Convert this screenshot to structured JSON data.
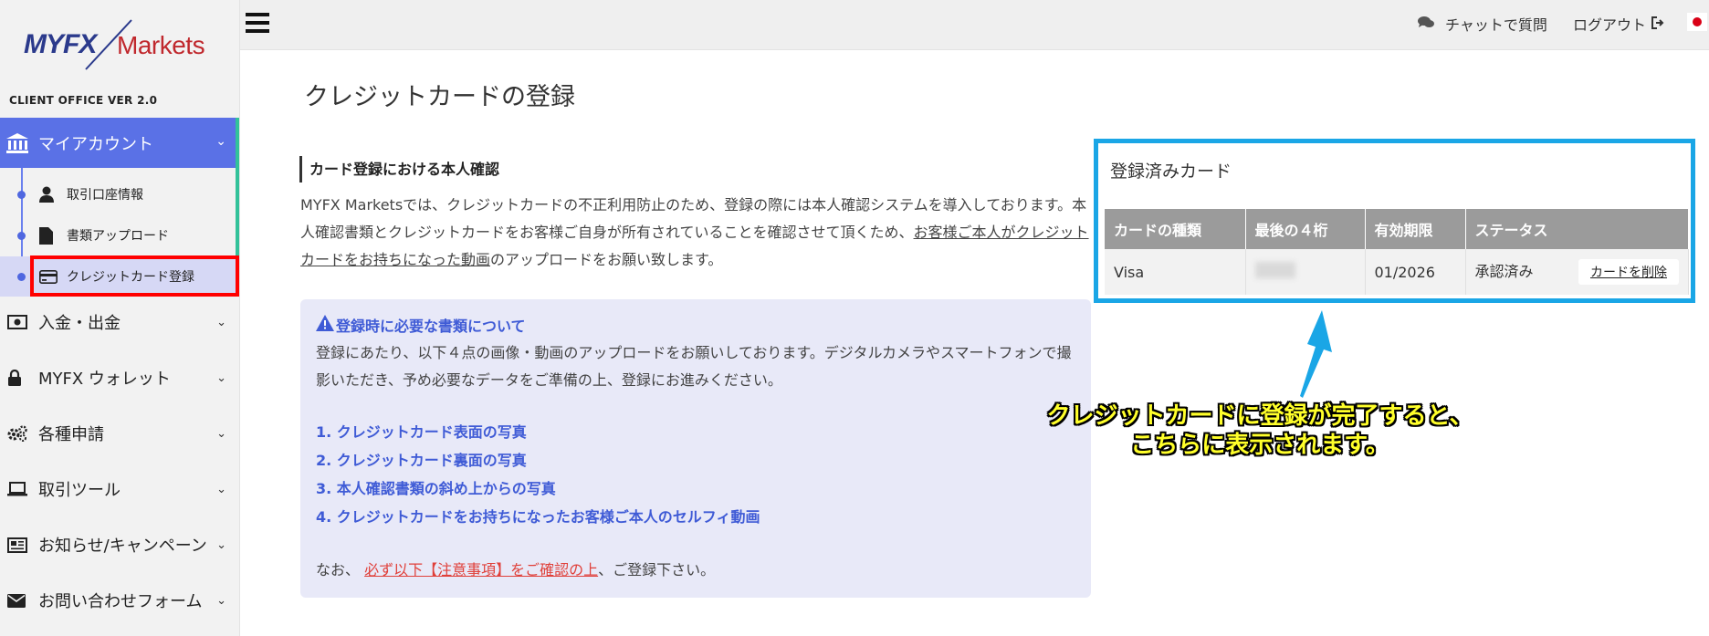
{
  "brand": {
    "logo_main": "MYFX",
    "logo_sub": "Markets",
    "client_office": "CLIENT OFFICE VER 2.0"
  },
  "sidebar": {
    "account_header": "マイアカウント",
    "sub_items": [
      {
        "label": "取引口座情報",
        "icon": "user-icon"
      },
      {
        "label": "書類アップロード",
        "icon": "file-icon"
      },
      {
        "label": "クレジットカード登録",
        "icon": "credit-card-icon",
        "active": true
      }
    ],
    "items": [
      {
        "label": "入金・出金",
        "icon": "money-icon"
      },
      {
        "label": "MYFX ウォレット",
        "icon": "lock-icon"
      },
      {
        "label": "各種申請",
        "icon": "gears-icon"
      },
      {
        "label": "取引ツール",
        "icon": "laptop-icon"
      },
      {
        "label": "お知らせ/キャンペーン",
        "icon": "newspaper-icon"
      },
      {
        "label": "お問い合わせフォーム",
        "icon": "envelope-icon"
      }
    ]
  },
  "header": {
    "chat_label": "チャットで質問",
    "logout_label": "ログアウト"
  },
  "main": {
    "page_title": "クレジットカードの登録",
    "section_title": "カード登録における本人確認",
    "intro_part1": "MYFX Marketsでは、クレジットカードの不正利用防止のため、登録の際には本人確認システムを導入しております。本人確認書類とクレジットカードをお客様ご自身が所有されていることを確認させて頂くため、",
    "intro_link": "お客様ご本人がクレジットカードをお持ちになった動画",
    "intro_part2": "のアップロードをお願い致します。",
    "notice": {
      "title": "登録時に必要な書類について",
      "body": "登録にあたり、以下４点の画像・動画のアップロードをお願いしております。デジタルカメラやスマートフォンで撮影いただき、予め必要なデータをご準備の上、登録にお進みください。",
      "steps": [
        "1. クレジットカード表面の写真",
        "2. クレジットカード裏面の写真",
        "3. 本人確認書類の斜め上からの写真",
        "4. クレジットカードをお持ちになったお客様ご本人のセルフィ動画"
      ],
      "footer_prefix": "なお、",
      "footer_link": "必ず以下【注意事項】をご確認の上",
      "footer_suffix": "、ご登録下さい。"
    }
  },
  "registered_cards": {
    "title": "登録済みカード",
    "columns": [
      "カードの種類",
      "最後の４桁",
      "有効期限",
      "ステータス"
    ],
    "rows": [
      {
        "type": "Visa",
        "last4": "",
        "expiry": "01/2026",
        "status": "承認済み",
        "action": "カードを削除"
      }
    ]
  },
  "annotation": {
    "line1": "クレジットカードに登録が完了すると、",
    "line2": "こちらに表示されます。",
    "frame_color": "#1aa6e6",
    "highlight_color": "#ff0000",
    "text_color": "#ffff2a"
  },
  "colors": {
    "accent": "#5a71e6",
    "link_blue": "#3f5bd6",
    "active_bg": "#d6d8f5"
  }
}
